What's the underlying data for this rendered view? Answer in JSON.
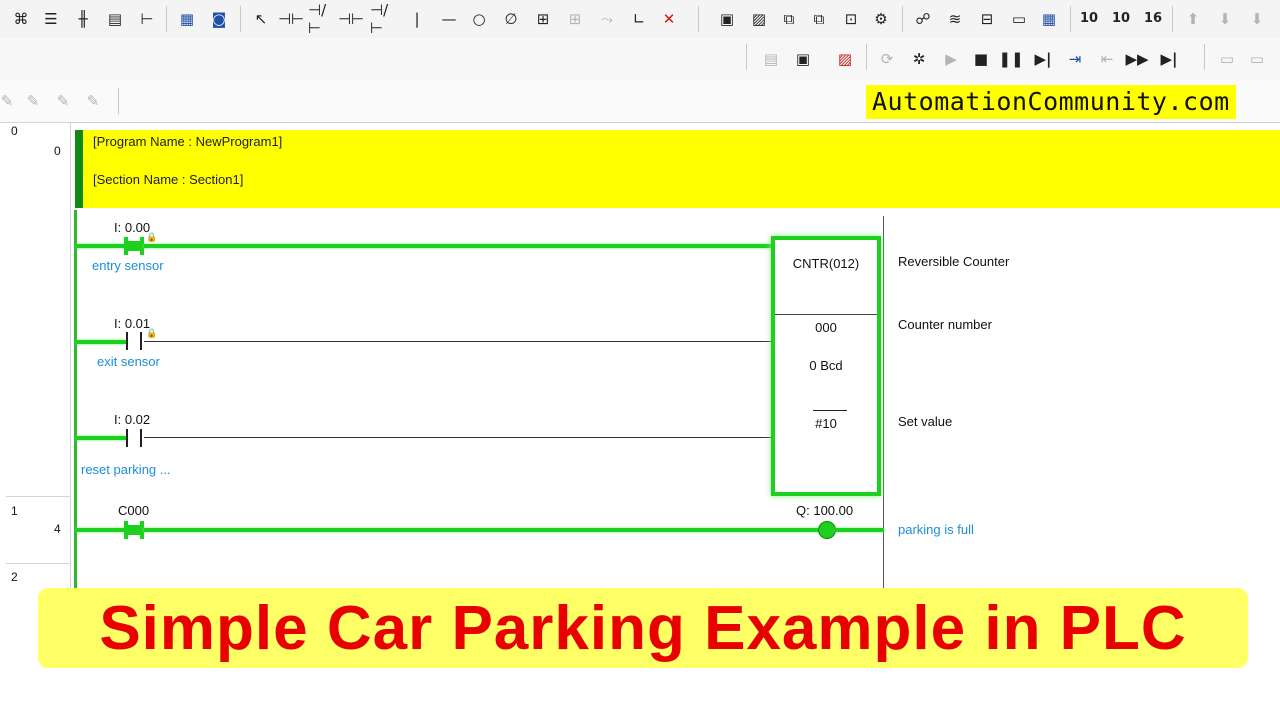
{
  "brand": "AutomationCommunity.com",
  "header": {
    "program_line": "[Program Name : NewProgram1]",
    "section_line": "[Section Name : Section1]"
  },
  "rungs": [
    {
      "index": "0",
      "step": "0"
    },
    {
      "index": "1",
      "step": "4"
    },
    {
      "index": "2",
      "step": ""
    }
  ],
  "contacts": [
    {
      "address": "I: 0.00",
      "comment": "entry sensor"
    },
    {
      "address": "I: 0.01",
      "comment": "exit sensor"
    },
    {
      "address": "I: 0.02",
      "comment": "reset parking ..."
    },
    {
      "address": "C000",
      "comment": ""
    }
  ],
  "function_block": {
    "name": "CNTR(012)",
    "counter": "000",
    "bcd": "0 Bcd",
    "set_value": "#10",
    "desc_name": "Reversible Counter",
    "desc_counter": "Counter number",
    "desc_set": "Set value"
  },
  "output": {
    "address": "Q: 100.00",
    "comment": "parking is full"
  },
  "title": "Simple Car Parking Example in PLC",
  "colors": {
    "accent_green": "#1ed01e",
    "header_yellow": "#ffff00",
    "title_red": "#e80000",
    "comment_blue": "#1b8fd6"
  }
}
